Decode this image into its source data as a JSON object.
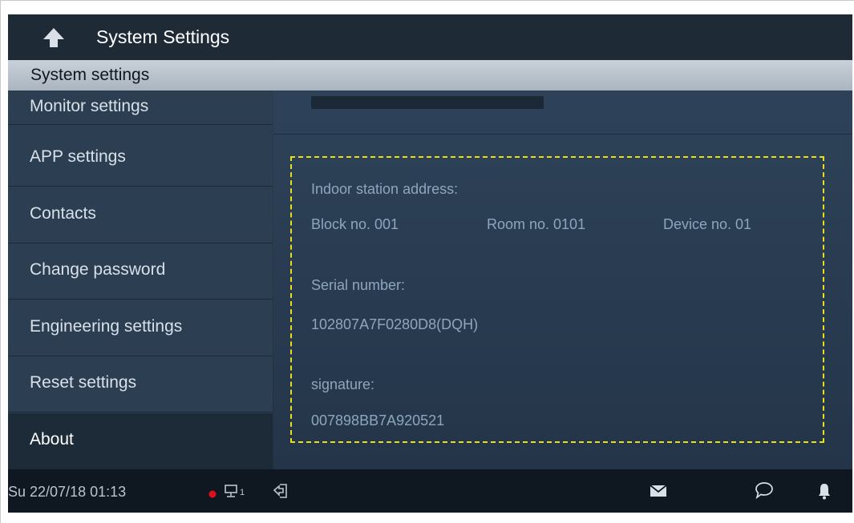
{
  "title_bar": {
    "title": "System Settings",
    "back_icon": "up-arrow-icon"
  },
  "section_header": {
    "label": "System settings"
  },
  "sidebar": {
    "items": [
      {
        "label": "Monitor settings",
        "active": false
      },
      {
        "label": "APP settings",
        "active": false
      },
      {
        "label": "Contacts",
        "active": false
      },
      {
        "label": "Change password",
        "active": false
      },
      {
        "label": "Engineering settings",
        "active": false
      },
      {
        "label": "Reset settings",
        "active": false
      },
      {
        "label": "About",
        "active": true
      }
    ]
  },
  "about": {
    "address_label": "Indoor station address:",
    "block": "Block no.  001",
    "room": "Room no.  0101",
    "device": "Device no.  01",
    "serial_label": "Serial number:",
    "serial_value": "102807A7F0280D8(DQH)",
    "signature_label": "signature:",
    "signature_value": "007898BB7A920521"
  },
  "status_bar": {
    "datetime": "Su 22/07/18  01:13",
    "network_sub": "1",
    "icons": [
      "recording-dot-icon",
      "network-icon",
      "exit-home-icon",
      "mail-icon",
      "chat-icon",
      "bell-icon"
    ]
  },
  "colors": {
    "accent_dashed": "#e8df1a",
    "record_dot": "#e0101a"
  }
}
